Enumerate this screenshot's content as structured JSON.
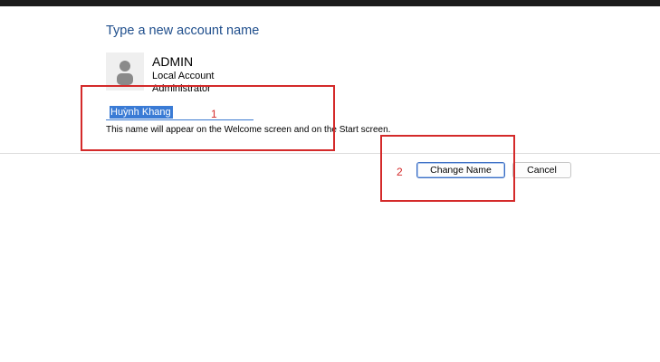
{
  "dialog": {
    "heading": "Type a new account name",
    "account": {
      "name": "ADMIN",
      "type": "Local Account",
      "role": "Administrator"
    },
    "name_input_value": "Huỳnh Khang",
    "hint": "This name will appear on the Welcome screen and on the Start screen.",
    "buttons": {
      "change_name": "Change Name",
      "cancel": "Cancel"
    }
  },
  "annotations": {
    "label_1": "1",
    "label_2": "2",
    "color": "#d42a2a"
  },
  "icons": {
    "avatar": "user-silhouette-icon"
  }
}
